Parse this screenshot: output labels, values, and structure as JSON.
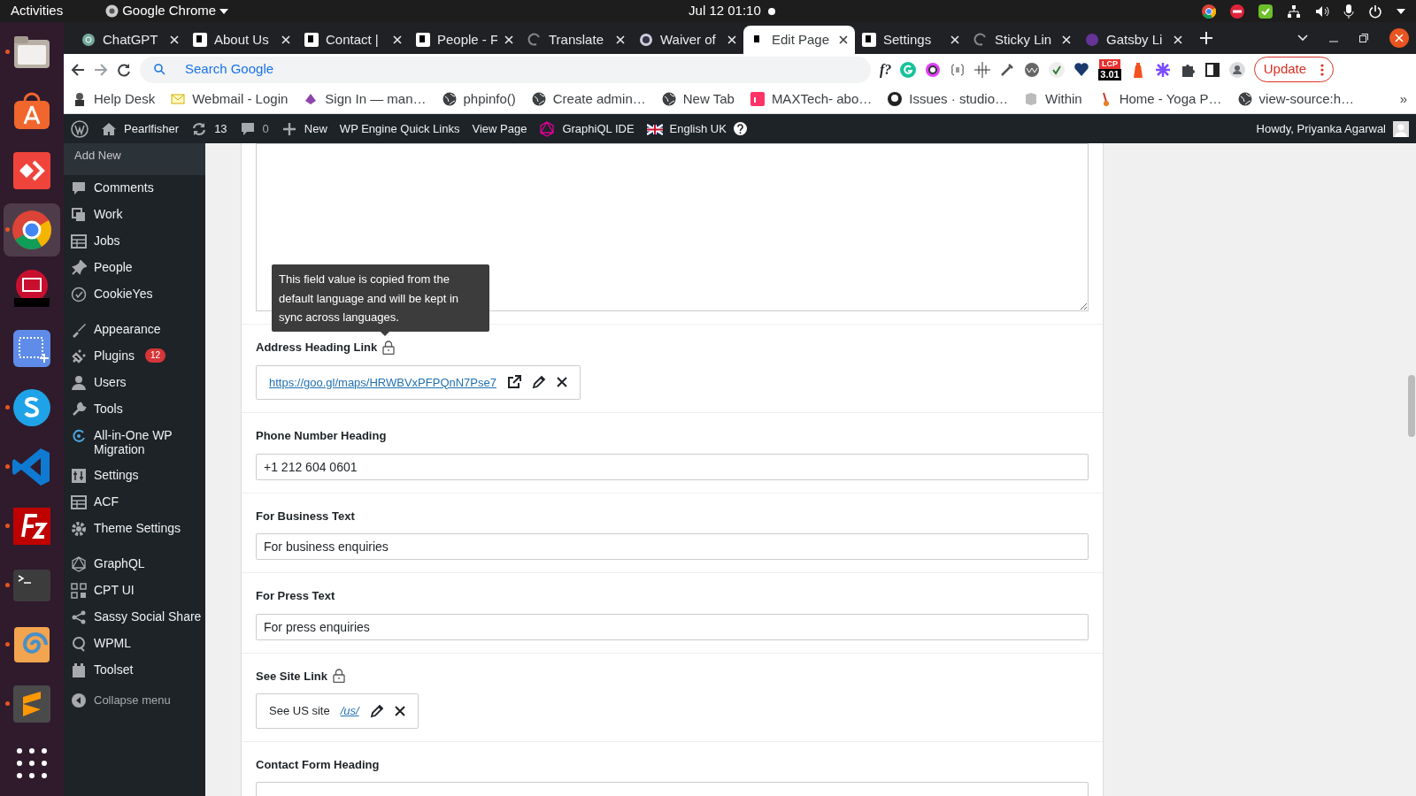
{
  "topbar": {
    "activities": "Activities",
    "app": "Google Chrome",
    "clock": "Jul 12  01:10"
  },
  "dock": [
    {
      "running": true,
      "selected": false
    },
    {
      "running": false,
      "selected": false
    },
    {
      "running": false,
      "selected": false
    },
    {
      "running": true,
      "selected": true
    },
    {
      "running": false,
      "selected": false
    },
    {
      "running": false,
      "selected": false
    },
    {
      "running": true,
      "selected": false
    },
    {
      "running": true,
      "selected": false
    },
    {
      "running": true,
      "selected": false
    },
    {
      "running": true,
      "selected": false
    },
    {
      "running": true,
      "selected": false
    },
    {
      "running": true,
      "selected": false
    },
    {
      "running": false,
      "selected": false
    }
  ],
  "tabs": [
    {
      "label": "ChatGPT",
      "selected": false
    },
    {
      "label": "About Us",
      "selected": false
    },
    {
      "label": "Contact |",
      "selected": false
    },
    {
      "label": "People - F",
      "selected": false
    },
    {
      "label": "Translate",
      "selected": false
    },
    {
      "label": "Waiver of",
      "selected": false
    },
    {
      "label": "Edit Page",
      "selected": true
    },
    {
      "label": "Settings",
      "selected": false
    },
    {
      "label": "Sticky Lin",
      "selected": false
    },
    {
      "label": "Gatsby Li",
      "selected": false
    }
  ],
  "toolbar": {
    "search_placeholder": "Search Google",
    "extension_text": "f?",
    "lcp_label": "LCP",
    "lcp_value": "3.01",
    "update_button": "Update"
  },
  "bookmarks": [
    "Help Desk",
    "Webmail - Login",
    "Sign In — man…",
    "phpinfo()",
    "Create admin…",
    "New Tab",
    "MAXTech- abo…",
    "Issues · studio…",
    "Within",
    "Home - Yoga P…",
    "view-source:h…"
  ],
  "bookmarks_more": "»",
  "admin_bar": {
    "site": "Pearlfisher",
    "updates": "13",
    "comments": "0",
    "new": "New",
    "links": [
      "WP Engine Quick Links",
      "View Page",
      "GraphiQL IDE"
    ],
    "language": "English UK",
    "greeting": "Howdy, Priyanka Agarwal"
  },
  "sidebar": {
    "submenu": [
      "Add New"
    ],
    "groups": [
      [
        {
          "label": "Comments"
        },
        {
          "label": "Work"
        },
        {
          "label": "Jobs"
        },
        {
          "label": "People"
        },
        {
          "label": "CookieYes"
        }
      ],
      [
        {
          "label": "Appearance"
        },
        {
          "label": "Plugins",
          "badge": "12"
        },
        {
          "label": "Users"
        },
        {
          "label": "Tools"
        },
        {
          "label": "All-in-One WP Migration"
        },
        {
          "label": "Settings"
        },
        {
          "label": "ACF"
        },
        {
          "label": "Theme Settings"
        }
      ],
      [
        {
          "label": "GraphQL"
        },
        {
          "label": "CPT UI"
        },
        {
          "label": "Sassy Social Share"
        },
        {
          "label": "WPML"
        },
        {
          "label": "Toolset"
        }
      ]
    ],
    "collapse": "Collapse menu"
  },
  "form": {
    "tooltip": "This field value is copied from the default language and will be kept in sync across languages.",
    "fields": [
      {
        "kind": "textarea"
      },
      {
        "kind": "link",
        "label": "Address Heading Link",
        "locked": true,
        "url": "https://goo.gl/maps/HRWBVxPFPQnN7Pse7",
        "external": true
      },
      {
        "kind": "text",
        "label": "Phone Number Heading",
        "locked": false,
        "value": "+1 212 604 0601"
      },
      {
        "kind": "text",
        "label": "For Business Text",
        "locked": false,
        "value": "For business enquiries"
      },
      {
        "kind": "text",
        "label": "For Press Text",
        "locked": false,
        "value": "For press enquiries"
      },
      {
        "kind": "link",
        "label": "See Site Link",
        "locked": true,
        "title": "See US site",
        "url": "/us/",
        "external": false
      },
      {
        "kind": "text",
        "label": "Contact Form Heading",
        "locked": false
      }
    ]
  }
}
